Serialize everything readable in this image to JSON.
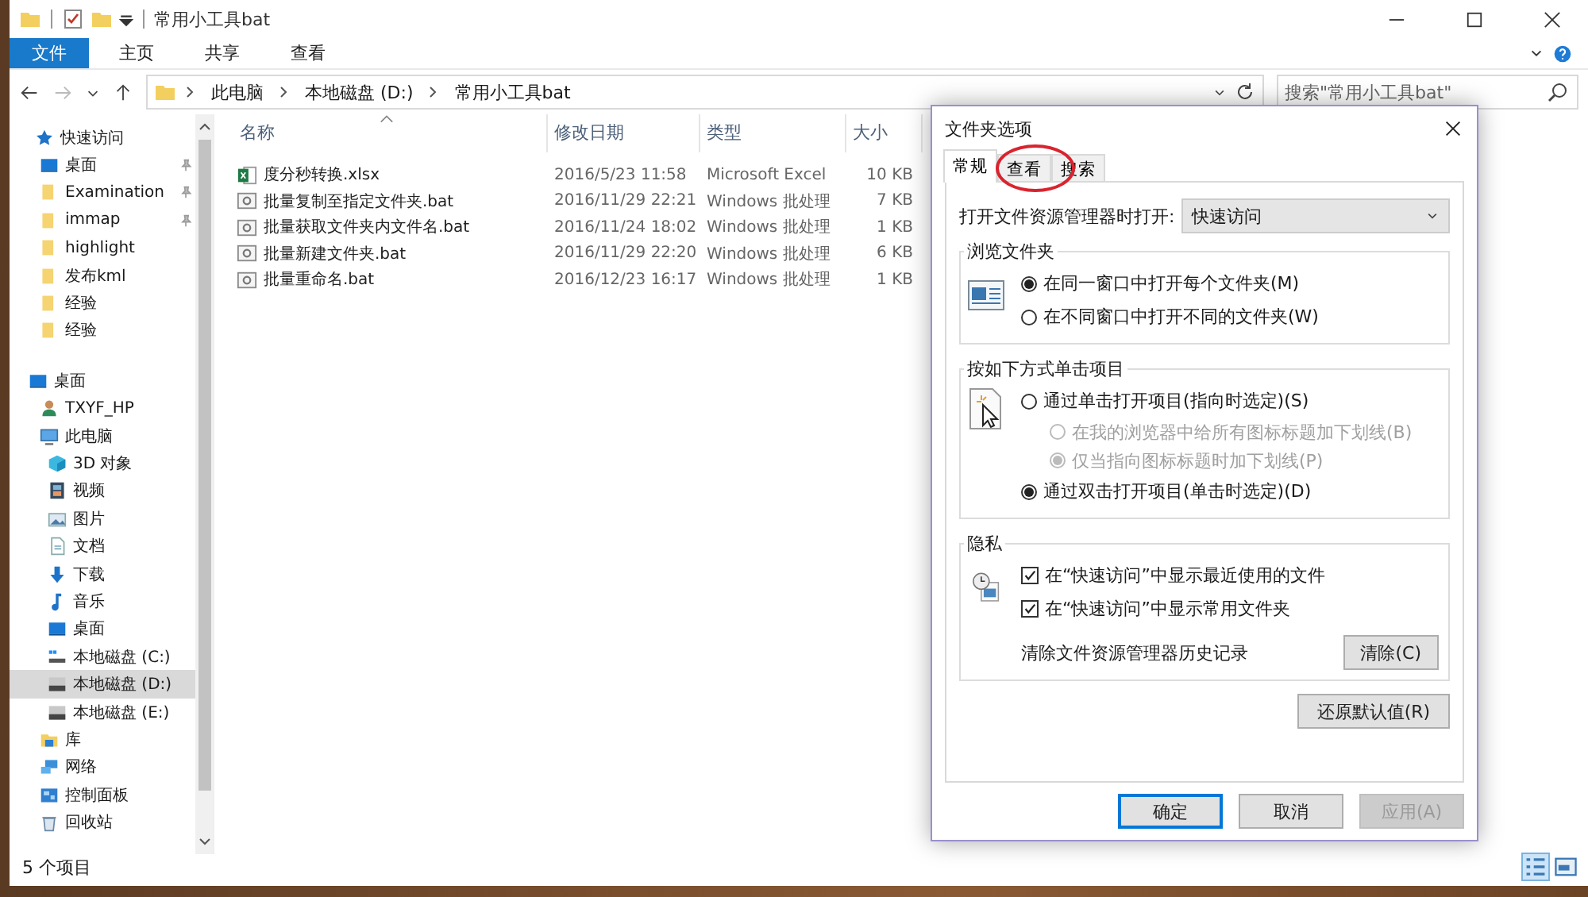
{
  "window": {
    "title": "常用小工具bat"
  },
  "ribbon_tabs": [
    {
      "label": "文件",
      "kind": "file",
      "selected": false
    },
    {
      "label": "主页",
      "kind": "tab",
      "selected": false
    },
    {
      "label": "共享",
      "kind": "tab",
      "selected": false
    },
    {
      "label": "查看",
      "kind": "tab",
      "selected": false
    }
  ],
  "address": {
    "path": [
      "此电脑",
      "本地磁盘 (D:)",
      "常用小工具bat"
    ]
  },
  "search": {
    "placeholder": "搜索\"常用小工具bat\""
  },
  "nav": [
    {
      "label": "快速访问",
      "kind": "star",
      "selected": false,
      "children": [
        {
          "label": "桌面",
          "kind": "desktop",
          "selected": false,
          "pinned": true
        },
        {
          "label": "Examination",
          "kind": "folder",
          "selected": false,
          "pinned": true
        },
        {
          "label": "immap",
          "kind": "folder",
          "selected": false,
          "pinned": true
        },
        {
          "label": "highlight",
          "kind": "folder",
          "selected": false,
          "pinned": false
        },
        {
          "label": "发布kml",
          "kind": "folder",
          "selected": false,
          "pinned": false
        },
        {
          "label": "经验",
          "kind": "folder",
          "selected": false,
          "pinned": false
        },
        {
          "label": "经验",
          "kind": "folder",
          "selected": false,
          "pinned": false
        }
      ]
    },
    {
      "label": "桌面",
      "kind": "desktop",
      "selected": false,
      "children": [
        {
          "label": "TXYF_HP",
          "kind": "user",
          "selected": false
        },
        {
          "label": "此电脑",
          "kind": "pc",
          "selected": false,
          "children": [
            {
              "label": "3D 对象",
              "kind": "cube",
              "selected": false
            },
            {
              "label": "视频",
              "kind": "video",
              "selected": false
            },
            {
              "label": "图片",
              "kind": "picture",
              "selected": false
            },
            {
              "label": "文档",
              "kind": "doc",
              "selected": false
            },
            {
              "label": "下载",
              "kind": "download",
              "selected": false
            },
            {
              "label": "音乐",
              "kind": "music",
              "selected": false
            },
            {
              "label": "桌面",
              "kind": "desktop",
              "selected": false
            },
            {
              "label": "本地磁盘 (C:)",
              "kind": "sysdrive",
              "selected": false
            },
            {
              "label": "本地磁盘 (D:)",
              "kind": "drive",
              "selected": true
            },
            {
              "label": "本地磁盘 (E:)",
              "kind": "drive",
              "selected": false
            }
          ]
        },
        {
          "label": "库",
          "kind": "library",
          "selected": false
        },
        {
          "label": "网络",
          "kind": "network",
          "selected": false
        },
        {
          "label": "控制面板",
          "kind": "control",
          "selected": false
        },
        {
          "label": "回收站",
          "kind": "recycle",
          "selected": false
        }
      ]
    }
  ],
  "files": {
    "columns": [
      "名称",
      "修改日期",
      "类型",
      "大小"
    ],
    "rows": [
      {
        "kind": "excel",
        "cells": [
          "度分秒转换.xlsx",
          "2016/5/23 11:58",
          "Microsoft Excel",
          "10 KB"
        ]
      },
      {
        "kind": "bat",
        "cells": [
          "批量复制至指定文件夹.bat",
          "2016/11/29 22:21",
          "Windows 批处理",
          "7 KB"
        ]
      },
      {
        "kind": "bat",
        "cells": [
          "批量获取文件夹内文件名.bat",
          "2016/11/24 18:02",
          "Windows 批处理",
          "1 KB"
        ]
      },
      {
        "kind": "bat",
        "cells": [
          "批量新建文件夹.bat",
          "2016/11/29 22:20",
          "Windows 批处理",
          "6 KB"
        ]
      },
      {
        "kind": "bat",
        "cells": [
          "批量重命名.bat",
          "2016/12/23 16:17",
          "Windows 批处理",
          "1 KB"
        ]
      }
    ]
  },
  "status_bar": {
    "count": "5 个项目"
  },
  "dialog": {
    "title": "文件夹选项",
    "tabs": [
      {
        "label": "常规",
        "selected": true
      },
      {
        "label": "查看",
        "selected": false
      },
      {
        "label": "搜索",
        "selected": false
      }
    ],
    "open_with": {
      "label": "打开文件资源管理器时打开:",
      "value": "快速访问"
    },
    "browse": {
      "title": "浏览文件夹",
      "options": [
        {
          "label": "在同一窗口中打开每个文件夹(M)",
          "selected": true,
          "disabled": false
        },
        {
          "label": "在不同窗口中打开不同的文件夹(W)",
          "selected": false,
          "disabled": false
        }
      ]
    },
    "click": {
      "title": "按如下方式单击项目",
      "options": [
        {
          "label": "通过单击打开项目(指向时选定)(S)",
          "selected": false,
          "disabled": false,
          "children": [
            {
              "label": "在我的浏览器中给所有图标标题加下划线(B)",
              "selected": false,
              "disabled": true
            },
            {
              "label": "仅当指向图标标题时加下划线(P)",
              "selected": true,
              "disabled": true
            }
          ]
        },
        {
          "label": "通过双击打开项目(单击时选定)(D)",
          "selected": true,
          "disabled": false
        }
      ]
    },
    "privacy": {
      "title": "隐私",
      "checks": [
        {
          "label": "在“快速访问”中显示最近使用的文件",
          "checked": true
        },
        {
          "label": "在“快速访问”中显示常用文件夹",
          "checked": true
        }
      ],
      "clear_label": "清除文件资源管理器历史记录",
      "clear_button": "清除(C)"
    },
    "restore_button": "还原默认值(R)",
    "buttons": [
      {
        "label": "确定",
        "default": true,
        "disabled": false
      },
      {
        "label": "取消",
        "default": false,
        "disabled": false
      },
      {
        "label": "应用(A)",
        "default": false,
        "disabled": true
      }
    ]
  }
}
